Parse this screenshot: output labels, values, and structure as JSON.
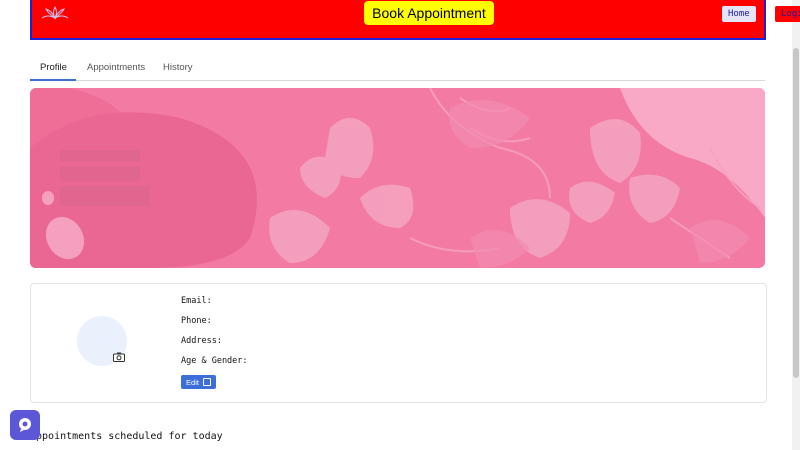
{
  "header": {
    "book_label": "Book Appointment",
    "home_label": "Home",
    "login_label": "Login",
    "logo_icon": "lotus-logo-icon"
  },
  "tabs": [
    {
      "label": "Profile",
      "active": true
    },
    {
      "label": "Appointments",
      "active": false
    },
    {
      "label": "History",
      "active": false
    }
  ],
  "profile": {
    "email_label": "Email:",
    "phone_label": "Phone:",
    "address_label": "Address:",
    "age_gender_label": "Age & Gender:",
    "edit_label": "Edit",
    "camera_icon": "camera-icon",
    "edit_icon": "edit-square-icon"
  },
  "today_label": "Appointments scheduled for today",
  "chat_icon": "chat-bot-icon",
  "colors": {
    "header_bg": "#ff0000",
    "header_border": "#1f1fd6",
    "book_bg": "#ffff00",
    "banner_bg": "#f37aa3",
    "accent": "#3c6fd8",
    "chat_bg": "#5b57d6"
  }
}
